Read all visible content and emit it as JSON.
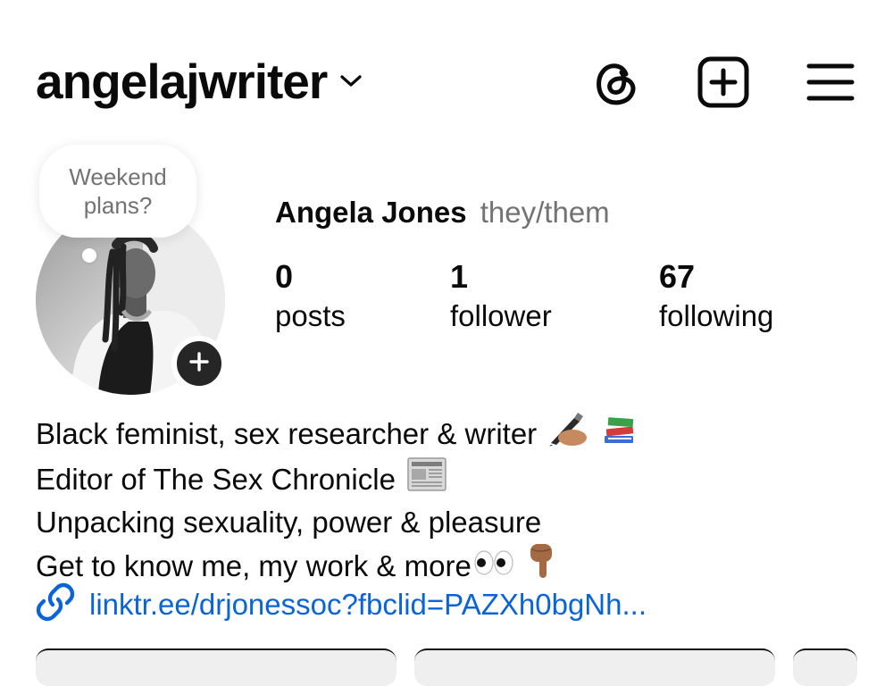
{
  "header": {
    "username": "angelajwriter"
  },
  "note": {
    "text": "Weekend plans?"
  },
  "profile": {
    "name": "Angela Jones",
    "pronouns": "they/them"
  },
  "stats": [
    {
      "value": "0",
      "label": "posts"
    },
    {
      "value": "1",
      "label": "follower"
    },
    {
      "value": "67",
      "label": "following"
    }
  ],
  "bio": {
    "line1": "Black feminist, sex researcher & writer",
    "line2": "Editor of The Sex Chronicle",
    "line3": "Unpacking sexuality, power & pleasure",
    "line4": "Get to know me, my work & more"
  },
  "link": {
    "text": "linktr.ee/drjonessoc?fbclid=PAZXh0bgNh..."
  },
  "colors": {
    "link": "#0a64d8",
    "secondary_text": "#737373",
    "dark_badge": "#262626"
  },
  "icons": {
    "threads": "threads-icon",
    "new_post": "add-square-icon",
    "menu": "hamburger-menu-icon",
    "link": "link-icon",
    "add_story": "plus-icon",
    "username_dropdown": "chevron-down-icon"
  }
}
